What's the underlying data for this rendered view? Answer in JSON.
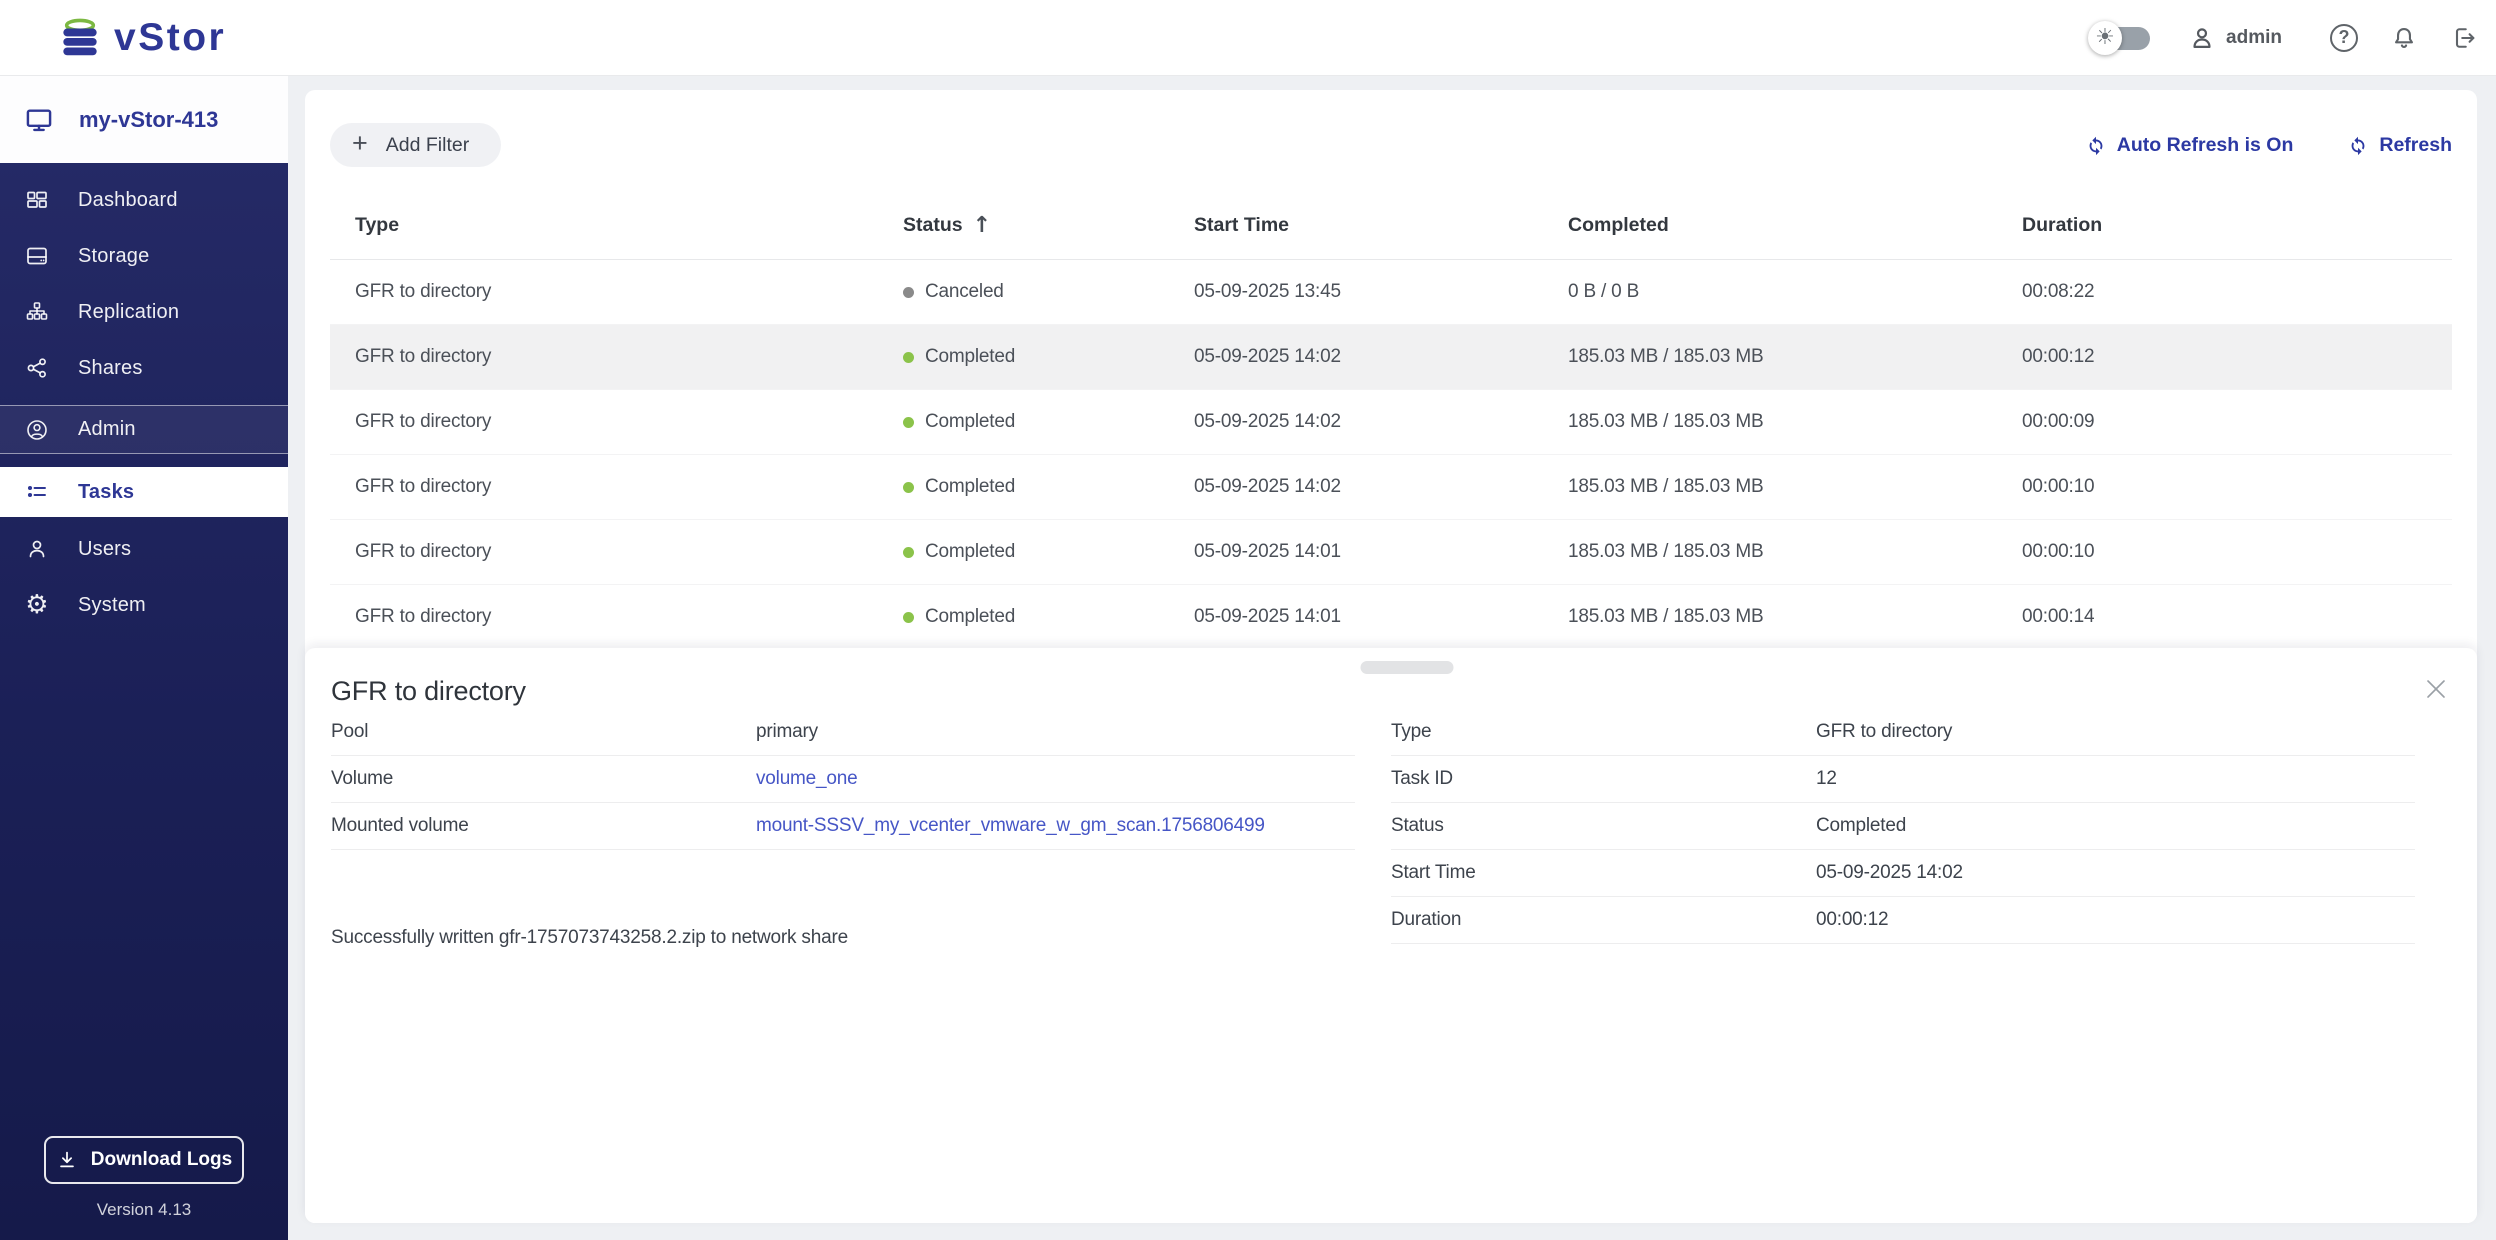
{
  "header": {
    "logo_text": "vStor",
    "user_name": "admin"
  },
  "sidebar": {
    "host": "my-vStor-413",
    "items": {
      "dashboard": "Dashboard",
      "storage": "Storage",
      "replication": "Replication",
      "shares": "Shares",
      "admin": "Admin",
      "tasks": "Tasks",
      "users": "Users",
      "system": "System"
    },
    "download_logs": "Download Logs",
    "version": "Version 4.13"
  },
  "toolbar": {
    "add_filter": "Add Filter",
    "auto_refresh": "Auto Refresh is On",
    "refresh": "Refresh"
  },
  "table": {
    "columns": [
      "Type",
      "Status",
      "Start Time",
      "Completed",
      "Duration"
    ],
    "rows": [
      {
        "type": "GFR to directory",
        "status": "Canceled",
        "status_color": "#8a8a8a",
        "start": "05-09-2025 13:45",
        "completed": "0 B / 0 B",
        "duration": "00:08:22",
        "selected": false
      },
      {
        "type": "GFR to directory",
        "status": "Completed",
        "status_color": "#8bc34a",
        "start": "05-09-2025 14:02",
        "completed": "185.03 MB / 185.03 MB",
        "duration": "00:00:12",
        "selected": true
      },
      {
        "type": "GFR to directory",
        "status": "Completed",
        "status_color": "#8bc34a",
        "start": "05-09-2025 14:02",
        "completed": "185.03 MB / 185.03 MB",
        "duration": "00:00:09",
        "selected": false
      },
      {
        "type": "GFR to directory",
        "status": "Completed",
        "status_color": "#8bc34a",
        "start": "05-09-2025 14:02",
        "completed": "185.03 MB / 185.03 MB",
        "duration": "00:00:10",
        "selected": false
      },
      {
        "type": "GFR to directory",
        "status": "Completed",
        "status_color": "#8bc34a",
        "start": "05-09-2025 14:01",
        "completed": "185.03 MB / 185.03 MB",
        "duration": "00:00:10",
        "selected": false
      },
      {
        "type": "GFR to directory",
        "status": "Completed",
        "status_color": "#8bc34a",
        "start": "05-09-2025 14:01",
        "completed": "185.03 MB / 185.03 MB",
        "duration": "00:00:14",
        "selected": false
      }
    ]
  },
  "detail": {
    "title": "GFR to directory",
    "left_fields": [
      {
        "label": "Pool",
        "value": "primary"
      },
      {
        "label": "Volume",
        "value": "volume_one"
      },
      {
        "label": "Mounted volume",
        "value": "mount-SSSV_my_vcenter_vmware_w_gm_scan.1756806499"
      }
    ],
    "right_fields": [
      {
        "label": "Type",
        "value": "GFR to directory"
      },
      {
        "label": "Task ID",
        "value": "12"
      },
      {
        "label": "Status",
        "value": "Completed"
      },
      {
        "label": "Start Time",
        "value": "05-09-2025 14:02"
      },
      {
        "label": "Duration",
        "value": "00:00:12"
      }
    ],
    "message": "Successfully written gfr-1757073743258.2.zip to network share"
  },
  "colors": {
    "accent": "#2e3795",
    "link": "#4656c6",
    "status_completed": "#8bc34a",
    "status_canceled": "#8a8a8a",
    "selected_row": "#f1f1f2",
    "sidebar_bg": "#1b2057",
    "logo_green": "#7cb842"
  }
}
